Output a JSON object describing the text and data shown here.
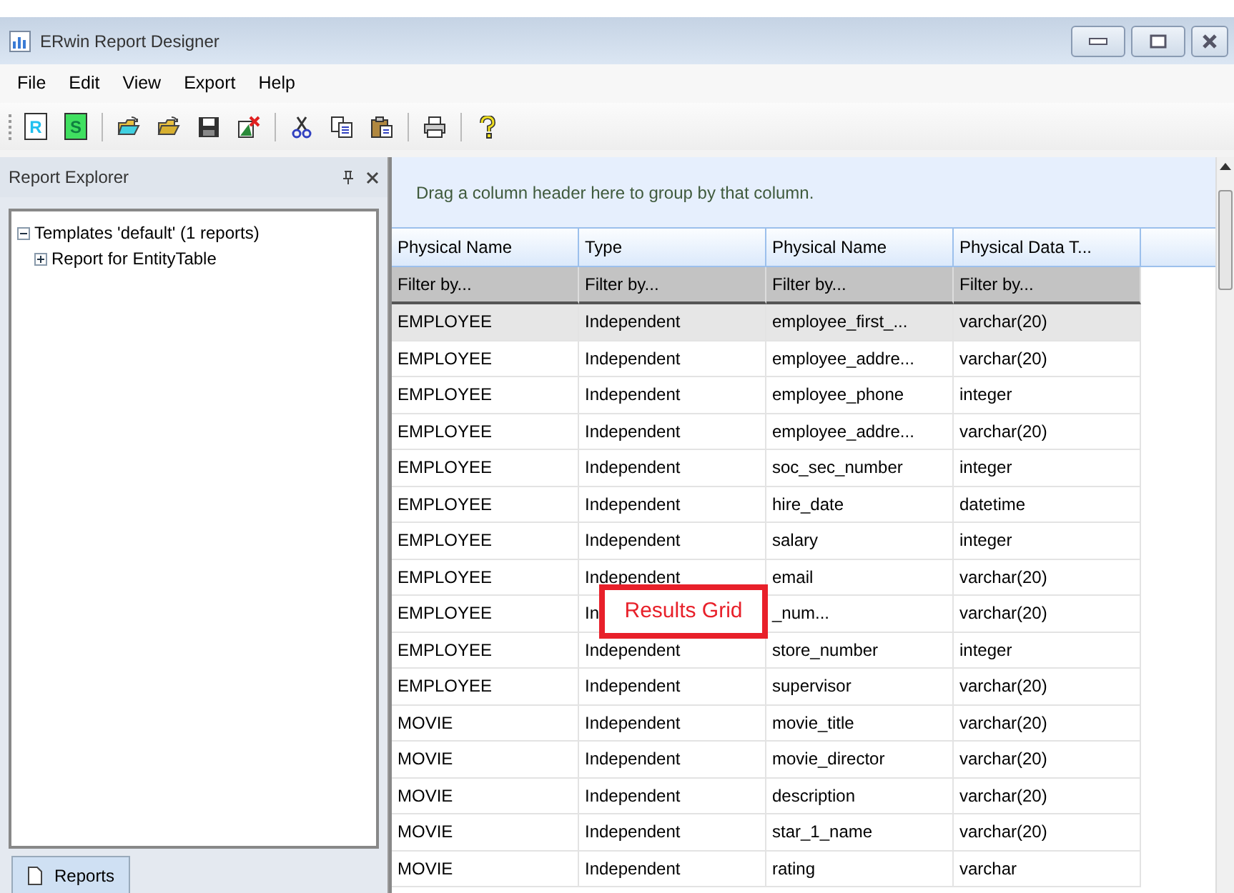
{
  "window": {
    "title": "ERwin Report Designer"
  },
  "menu": [
    "File",
    "Edit",
    "View",
    "Export",
    "Help"
  ],
  "toolbar": [
    {
      "kind": "doc",
      "label": "R"
    },
    {
      "kind": "doc",
      "label": "S"
    },
    {
      "kind": "sep"
    },
    {
      "kind": "open"
    },
    {
      "kind": "open2"
    },
    {
      "kind": "save"
    },
    {
      "kind": "delete"
    },
    {
      "kind": "sep"
    },
    {
      "kind": "cut"
    },
    {
      "kind": "copy"
    },
    {
      "kind": "paste"
    },
    {
      "kind": "sep"
    },
    {
      "kind": "print"
    },
    {
      "kind": "sep"
    },
    {
      "kind": "help"
    }
  ],
  "explorer": {
    "title": "Report Explorer",
    "tree": [
      {
        "label": "Templates 'default' (1 reports)",
        "expanded": true,
        "children": [
          {
            "label": "Report for EntityTable",
            "expanded": false
          }
        ]
      }
    ],
    "tabs": [
      {
        "label": "Reports",
        "selected": true
      }
    ]
  },
  "grid": {
    "group_hint": "Drag a column header here to group by that column.",
    "columns": [
      "Physical Name",
      "Type",
      "Physical Name",
      "Physical Data T..."
    ],
    "filters": [
      "Filter by...",
      "Filter by...",
      "Filter by...",
      "Filter by..."
    ],
    "rows": [
      {
        "cells": [
          "EMPLOYEE",
          "Independent",
          "employee_first_...",
          "varchar(20)"
        ],
        "selected": true
      },
      {
        "cells": [
          "EMPLOYEE",
          "Independent",
          "employee_addre...",
          "varchar(20)"
        ],
        "selected": false
      },
      {
        "cells": [
          "EMPLOYEE",
          "Independent",
          "employee_phone",
          "integer"
        ],
        "selected": false
      },
      {
        "cells": [
          "EMPLOYEE",
          "Independent",
          "employee_addre...",
          "varchar(20)"
        ],
        "selected": false
      },
      {
        "cells": [
          "EMPLOYEE",
          "Independent",
          "soc_sec_number",
          "integer"
        ],
        "selected": false
      },
      {
        "cells": [
          "EMPLOYEE",
          "Independent",
          "hire_date",
          "datetime"
        ],
        "selected": false
      },
      {
        "cells": [
          "EMPLOYEE",
          "Independent",
          "salary",
          "integer"
        ],
        "selected": false
      },
      {
        "cells": [
          "EMPLOYEE",
          "Independent",
          "email",
          "varchar(20)"
        ],
        "selected": false
      },
      {
        "cells": [
          "EMPLOYEE",
          "In",
          "_num...",
          "varchar(20)"
        ],
        "selected": false
      },
      {
        "cells": [
          "EMPLOYEE",
          "Independent",
          "store_number",
          "integer"
        ],
        "selected": false
      },
      {
        "cells": [
          "EMPLOYEE",
          "Independent",
          "supervisor",
          "varchar(20)"
        ],
        "selected": false
      },
      {
        "cells": [
          "MOVIE",
          "Independent",
          "movie_title",
          "varchar(20)"
        ],
        "selected": false
      },
      {
        "cells": [
          "MOVIE",
          "Independent",
          "movie_director",
          "varchar(20)"
        ],
        "selected": false
      },
      {
        "cells": [
          "MOVIE",
          "Independent",
          "description",
          "varchar(20)"
        ],
        "selected": false
      },
      {
        "cells": [
          "MOVIE",
          "Independent",
          "star_1_name",
          "varchar(20)"
        ],
        "selected": false
      },
      {
        "cells": [
          "MOVIE",
          "Independent",
          "rating",
          "varchar"
        ],
        "selected": false
      }
    ]
  },
  "annotation": {
    "label": "Results Grid"
  }
}
